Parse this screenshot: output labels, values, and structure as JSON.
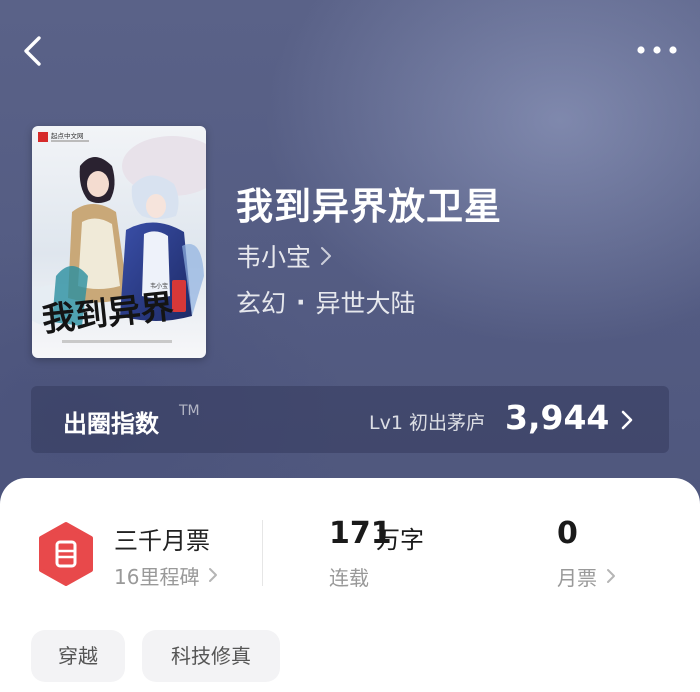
{
  "header": {
    "back_icon": "chevron-left-icon",
    "more_icon": "more-dots-icon"
  },
  "book": {
    "title": "我到异界放卫星",
    "author": "韦小宝",
    "genre_main": "玄幻",
    "genre_separator": "·",
    "genre_sub": "异世大陆",
    "cover": {
      "publisher_mark": "起点中文网",
      "title_art": "我到异界",
      "author_mark": "韦小宝"
    }
  },
  "index_bar": {
    "label": "出圈指数",
    "tm": "TM",
    "level": "Lv1 初出茅庐",
    "value": "3,944"
  },
  "stats": {
    "monthly_ticket": {
      "title": "三千月票",
      "sub": "16里程碑",
      "icon": "ticket-icon",
      "icon_color": "#e8494b"
    },
    "word_count": {
      "number": "171",
      "unit": "万字",
      "label": "连载"
    },
    "votes": {
      "number": "0",
      "label": "月票"
    }
  },
  "tags": [
    "穿越",
    "科技修真"
  ]
}
